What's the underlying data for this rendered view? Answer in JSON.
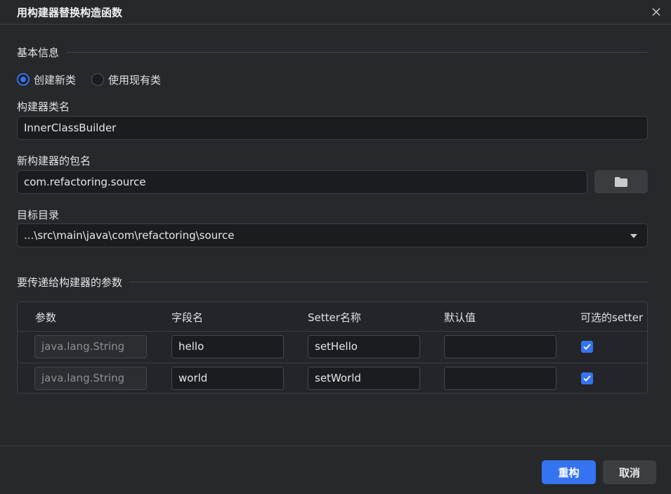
{
  "dialog": {
    "title": "用构建器替换构造函数",
    "close_icon": "close-icon"
  },
  "basic_info": {
    "section_title": "基本信息",
    "radio_options": [
      {
        "label": "创建新类",
        "selected": true
      },
      {
        "label": "使用现有类",
        "selected": false
      }
    ],
    "builder_class_label": "构建器类名",
    "builder_class_value": "InnerClassBuilder",
    "package_label": "新构建器的包名",
    "package_value": "com.refactoring.source",
    "browse_icon": "folder-icon",
    "target_dir_label": "目标目录",
    "target_dir_value": "...\\src\\main\\java\\com\\refactoring\\source"
  },
  "params": {
    "section_title": "要传递给构建器的参数",
    "columns": [
      "参数",
      "字段名",
      "Setter名称",
      "默认值",
      "可选的setter"
    ],
    "rows": [
      {
        "param": "java.lang.String",
        "field": "hello",
        "setter": "setHello",
        "default": "",
        "optional": true
      },
      {
        "param": "java.lang.String",
        "field": "world",
        "setter": "setWorld",
        "default": "",
        "optional": true
      }
    ]
  },
  "footer": {
    "refactor_label": "重构",
    "cancel_label": "取消"
  },
  "colors": {
    "accent": "#3574f0",
    "background": "#27282c",
    "input_bg": "#1b1c1f"
  }
}
